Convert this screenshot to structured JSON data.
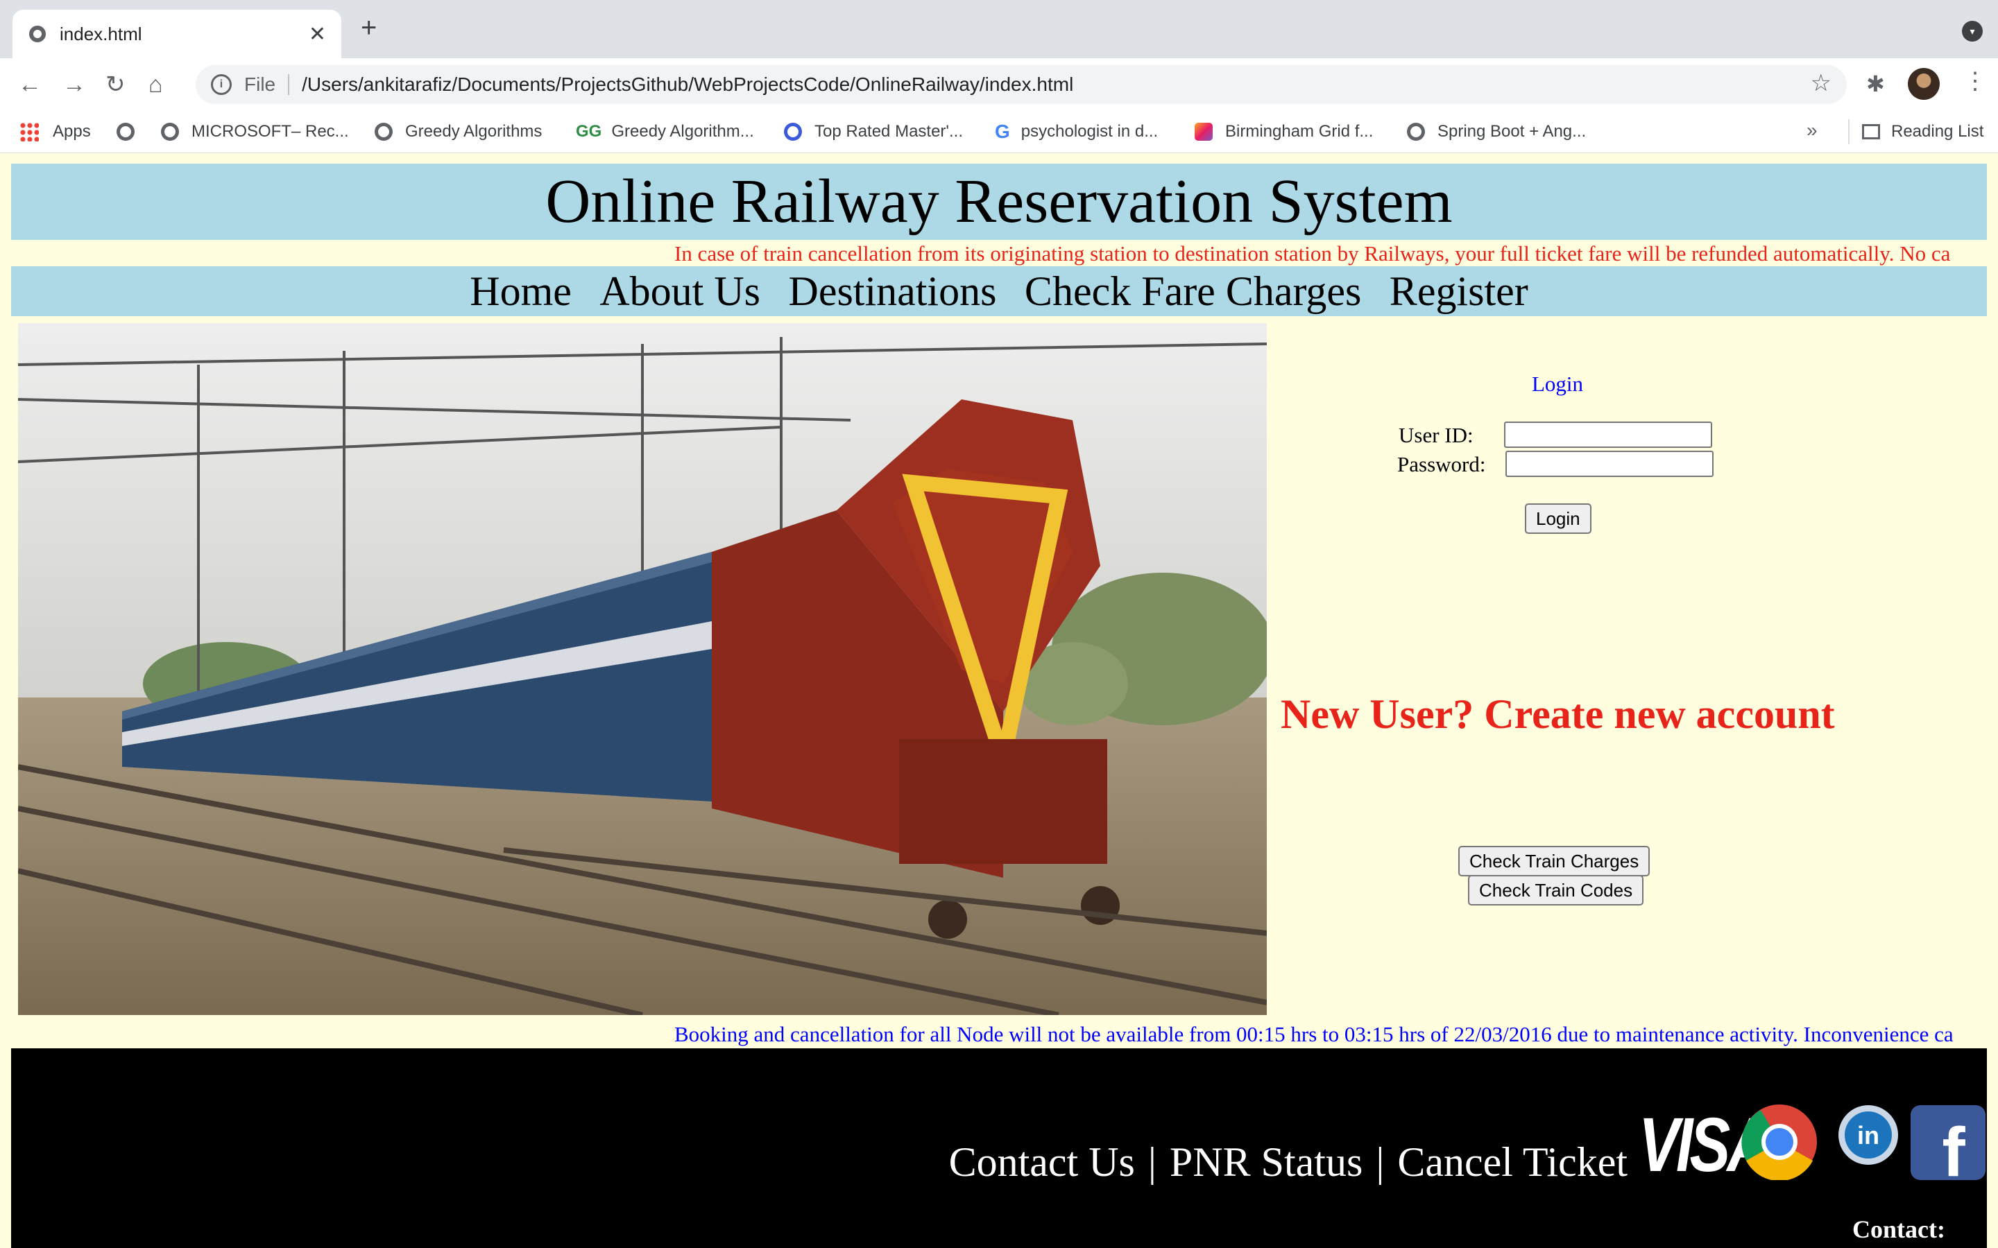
{
  "browser": {
    "tab_title": "index.html",
    "url_scheme": "File",
    "url": "/Users/ankitarafiz/Documents/ProjectsGithub/WebProjectsCode/OnlineRailway/index.html",
    "bookmarks": [
      "Apps",
      "",
      "MICROSOFT– Rec...",
      "Greedy Algorithms",
      "Greedy Algorithm...",
      "Top Rated Master'...",
      "psychologist in d...",
      "Birmingham Grid f...",
      "Spring Boot + Ang..."
    ],
    "more_bookmarks": "»",
    "reading_list": "Reading List"
  },
  "page": {
    "title": "Online Railway Reservation System",
    "top_notice": "In case of train cancellation from its originating station to destination station by Railways, your full ticket fare will be refunded automatically. No ca",
    "nav": [
      "Home",
      "About Us",
      "Destinations",
      "Check Fare Charges",
      "Register"
    ],
    "login": {
      "heading": "Login",
      "user_id_label": "User ID:",
      "password_label": "Password:",
      "submit": "Login"
    },
    "new_user": "New User? Create new account",
    "buttons": [
      "Check Train Charges",
      "Check Train Codes"
    ],
    "bottom_notice": "Booking and cancellation for all Node will not be available from 00:15 hrs to 03:15 hrs of 22/03/2016 due to maintenance activity. Inconvenience ca",
    "footer": {
      "links": [
        "Contact Us",
        "|",
        "PNR Status",
        "|",
        "Cancel Ticket"
      ],
      "visa": "VISA",
      "contact": "Contact:"
    }
  },
  "colors": {
    "page_bg": "#ffffe0",
    "banner_bg": "#add8e6",
    "notice_red": "#e8231a",
    "notice_blue": "#0000ff"
  }
}
